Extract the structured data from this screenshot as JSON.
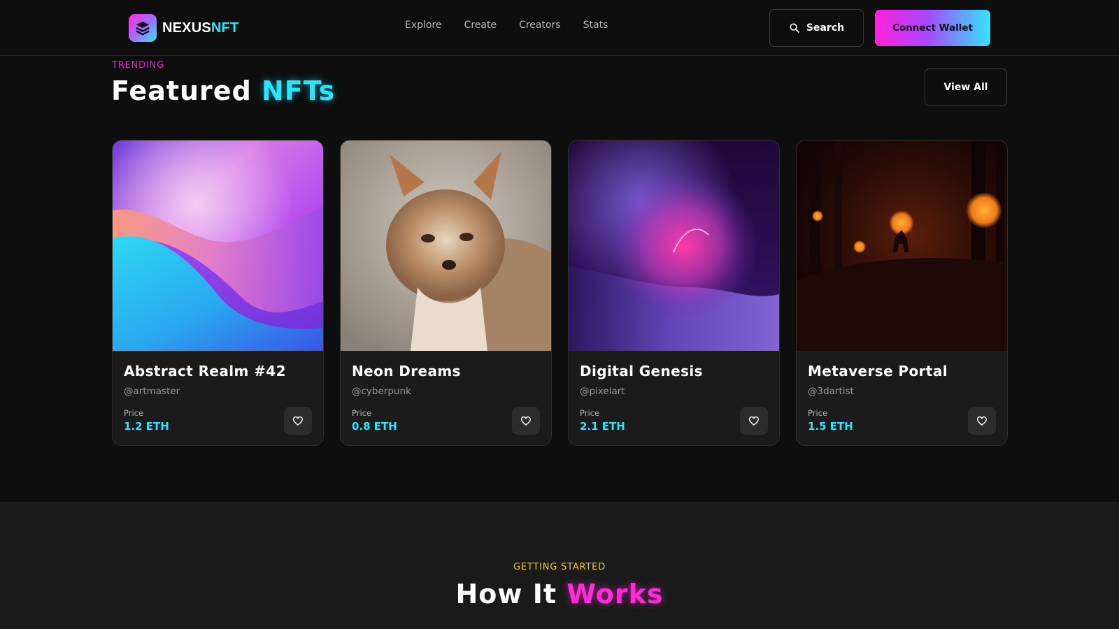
{
  "header": {
    "logo": {
      "text_a": "NEXUS",
      "text_b": "NFT",
      "icon": "layers-icon"
    },
    "nav": [
      "Explore",
      "Create",
      "Creators",
      "Stats"
    ],
    "search_label": "Search",
    "wallet_label": "Connect Wallet"
  },
  "featured": {
    "eyebrow": "TRENDING",
    "title_a": "Featured",
    "title_b": "NFTs",
    "view_all": "View All",
    "cards": [
      {
        "name": "Abstract Realm #42",
        "creator": "@artmaster",
        "price_label": "Price",
        "price": "1.2 ETH",
        "art": "abstract-waves-artwork"
      },
      {
        "name": "Neon Dreams",
        "creator": "@cyberpunk",
        "price_label": "Price",
        "price": "0.8 ETH",
        "art": "fox-photo-artwork"
      },
      {
        "name": "Digital Genesis",
        "creator": "@pixelart",
        "price_label": "Price",
        "price": "2.1 ETH",
        "art": "purple-glow-artwork"
      },
      {
        "name": "Metaverse Portal",
        "creator": "@3dartist",
        "price_label": "Price",
        "price": "1.5 ETH",
        "art": "dark-forest-deer-artwork"
      }
    ]
  },
  "how_it_works": {
    "eyebrow": "GETTING STARTED",
    "title_a": "How It",
    "title_b": "Works"
  },
  "colors": {
    "accent_cyan": "#27e6ff",
    "accent_pink": "#ff2bd6",
    "accent_yellow": "#f2c919",
    "background": "#0e0e0e"
  }
}
